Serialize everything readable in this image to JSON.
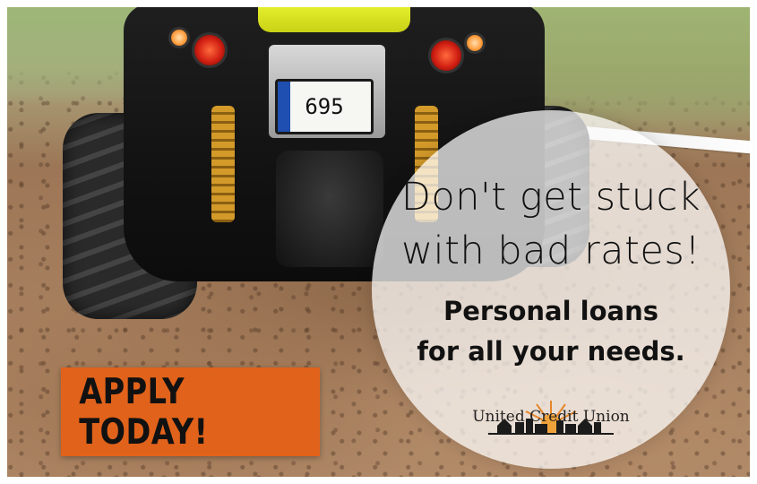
{
  "ad": {
    "headline_line1": "Don't get stuck",
    "headline_line2": "with bad rates!",
    "subhead_line1": "Personal loans",
    "subhead_line2": "for all your needs.",
    "cta_label": "APPLY TODAY!",
    "brand_name": "United Credit Union"
  },
  "scene": {
    "license_plate": "695"
  },
  "colors": {
    "cta_background": "#e1621a",
    "circle_overlay": "rgba(255,255,255,0.72)",
    "text": "#111111"
  },
  "icons": {
    "brand_logo": "sunrise-skyline-logo"
  }
}
